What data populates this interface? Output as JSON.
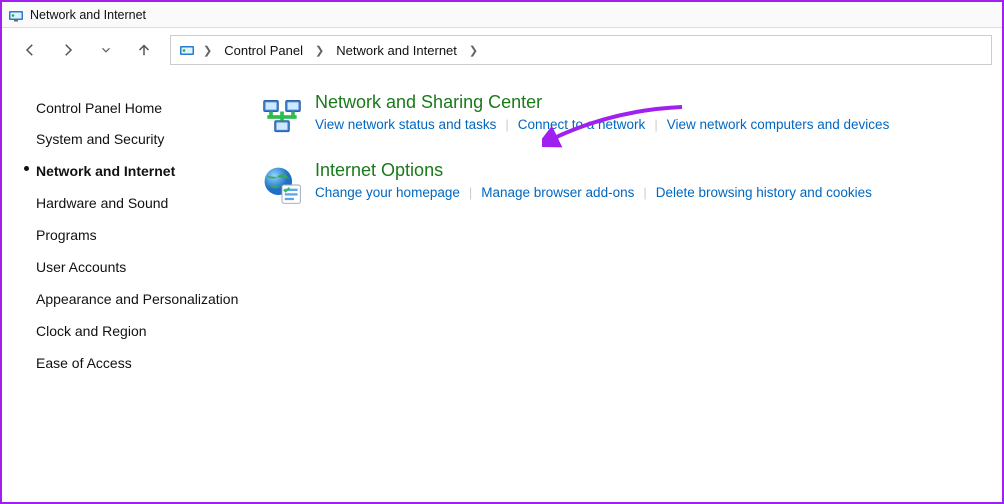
{
  "window": {
    "title": "Network and Internet"
  },
  "breadcrumb": {
    "items": [
      "Control Panel",
      "Network and Internet"
    ]
  },
  "sidebar": {
    "items": [
      {
        "label": "Control Panel Home",
        "active": false
      },
      {
        "label": "System and Security",
        "active": false
      },
      {
        "label": "Network and Internet",
        "active": true
      },
      {
        "label": "Hardware and Sound",
        "active": false
      },
      {
        "label": "Programs",
        "active": false
      },
      {
        "label": "User Accounts",
        "active": false
      },
      {
        "label": "Appearance and Personalization",
        "active": false
      },
      {
        "label": "Clock and Region",
        "active": false
      },
      {
        "label": "Ease of Access",
        "active": false
      }
    ]
  },
  "categories": [
    {
      "icon": "network-sharing-icon",
      "title": "Network and Sharing Center",
      "tasks": [
        "View network status and tasks",
        "Connect to a network",
        "View network computers and devices"
      ]
    },
    {
      "icon": "internet-options-icon",
      "title": "Internet Options",
      "tasks": [
        "Change your homepage",
        "Manage browser add-ons",
        "Delete browsing history and cookies"
      ]
    }
  ],
  "colors": {
    "link": "#0067c0",
    "heading": "#1a7a1a",
    "annotation": "#a020f0"
  }
}
